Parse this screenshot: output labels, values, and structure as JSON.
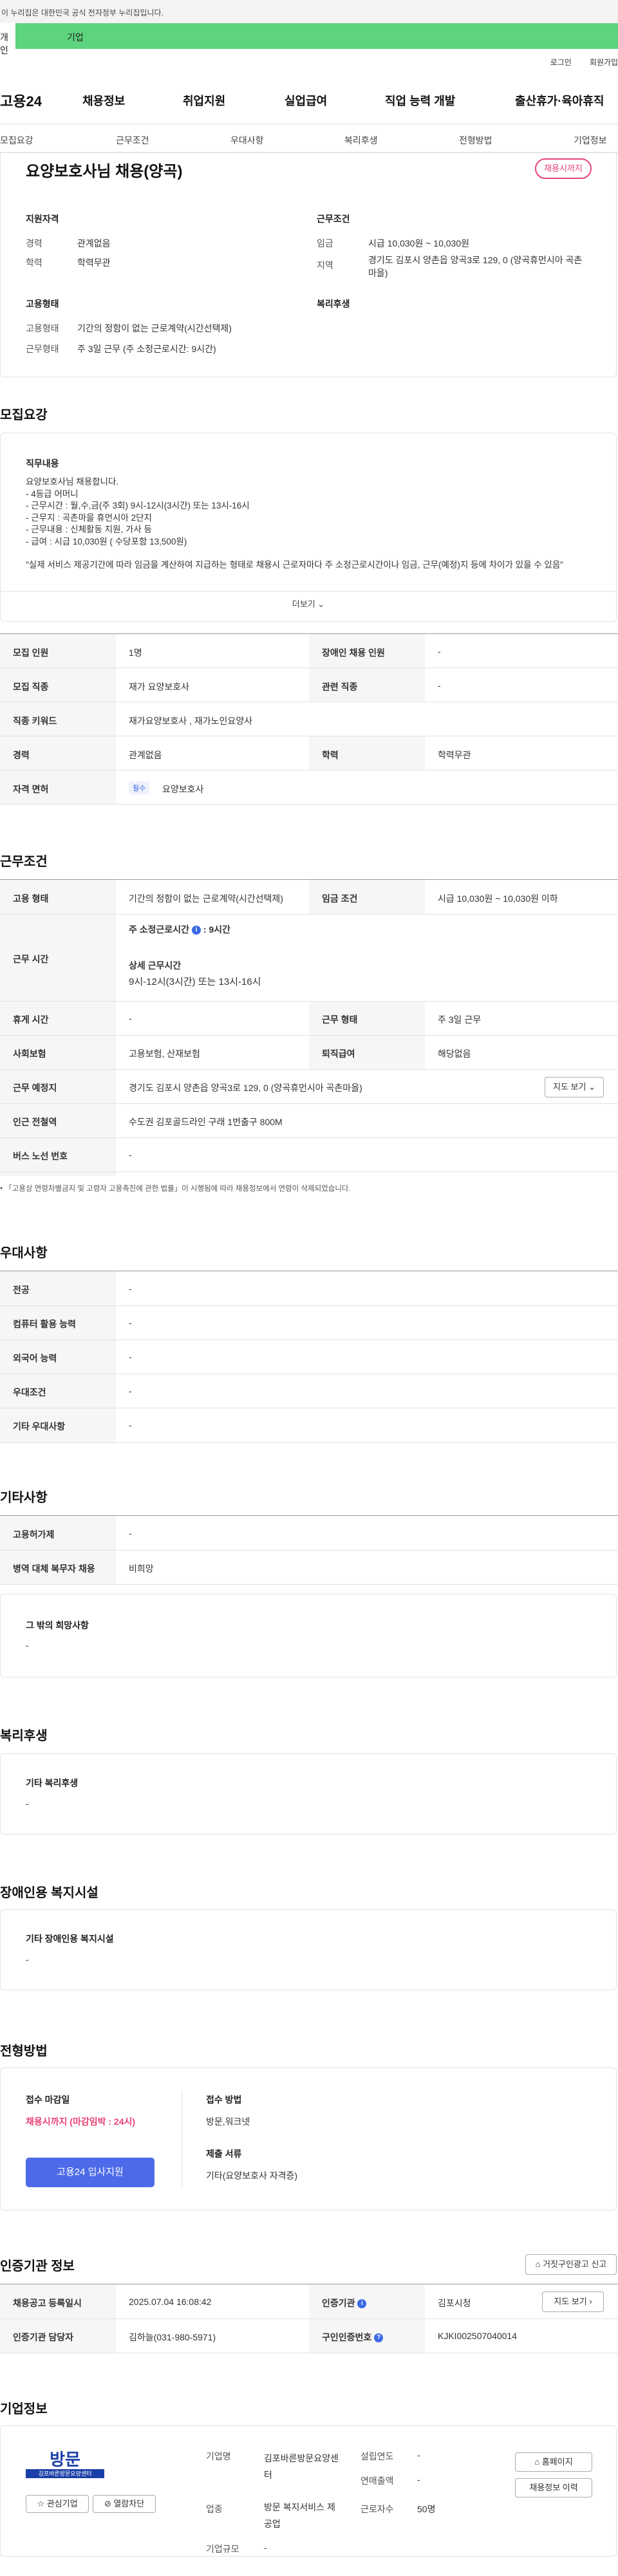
{
  "gov_banner": "이 누리집은 대한민국 공식 전자정부 누리집입니다.",
  "user_tabs": {
    "personal": "개인",
    "corporate": "기업"
  },
  "top_links": {
    "login": "로그인",
    "join": "회원가입"
  },
  "logo": "고용24",
  "gnb": [
    "채용정보",
    "취업지원",
    "실업급여",
    "직업 능력 개발",
    "출산휴가·육아휴직"
  ],
  "anchors": [
    "모집요강",
    "근무조건",
    "우대사항",
    "복리후생",
    "전형방법",
    "기업정보"
  ],
  "summary": {
    "title": "요양보호사님 채용(양곡)",
    "deadline_badge": "채용시까지",
    "qual_header": "지원자격",
    "career_label": "경력",
    "career_value": "관계없음",
    "edu_label": "학력",
    "edu_value": "학력무관",
    "cond_header": "근무조건",
    "wage_label": "임금",
    "wage_value": "시급 10,030원 ~ 10,030원",
    "region_label": "지역",
    "region_value": "경기도 김포시 양촌읍 양곡3로 129, 0 (양곡휴먼시아 곡촌마을)",
    "emp_header": "고용형태",
    "emptype_label": "고용형태",
    "emptype_value": "기간의 정함이 없는 근로계약(시간선택제)",
    "worktype_label": "근무형태",
    "worktype_value": "주 3일 근무 (주 소정근로시간: 9시간)",
    "welfare_header": "복리후생"
  },
  "recruit": {
    "section_title": "모집요강",
    "duty_header": "직무내용",
    "duty_lines": [
      "요양보호사님 채용합니다.",
      "- 4등급 어머니",
      "- 근무시간 : 월,수,금(주 3회)   9시-12시(3시간)  또는 13시-16시",
      "- 근무지 : 곡촌마을 휴먼시아 2단지",
      "- 근무내용 : 신체활동 지원, 가사 등",
      "- 급여 : 시급 10,030원 ( 수당포함 13,500원)",
      "",
      "\"실제 서비스 제공기간에 따라 임금을 계산하여 지급하는 형태로 채용시 근로자마다 주 소정근로시간이나 임금, 근무(예정)지 등에 차이가 있을 수 있음\""
    ],
    "more_label": "더보기",
    "rows": [
      {
        "l1": "모집 인원",
        "v1": "1명",
        "l2": "장애인 채용 인원",
        "v2": "-"
      },
      {
        "l1": "모집 직종",
        "v1": "재가 요양보호사",
        "l2": "관련 직종",
        "v2": "-"
      },
      {
        "l1": "직종 키워드",
        "v1": "재가요양보호사 , 재가노인요양사"
      },
      {
        "l1": "경력",
        "v1": "관계없음",
        "l2": "학력",
        "v2": "학력무관"
      },
      {
        "l1": "자격 면허",
        "tag": "필수",
        "v1": "요양보호사"
      }
    ]
  },
  "conditions": {
    "section_title": "근무조건",
    "emp_label": "고용 형태",
    "emp_value": "기간의 정함이 없는 근로계약(시간선택제)",
    "wage_label": "임금 조건",
    "wage_value": "시급 10,030원 ~ 10,030원 이하",
    "hours_label": "근무 시간",
    "weekly_label": "주 소정근로시간",
    "weekly_value": ": 9시간",
    "detail_label": "상세 근무시간",
    "detail_value": "9시-12시(3시간)  또는 13시-16시",
    "rest_label": "휴게 시간",
    "rest_value": "-",
    "worktype_label": "근무 형태",
    "worktype_value": "주 3일 근무",
    "ins_label": "사회보험",
    "ins_value": "고용보험, 산재보험",
    "retire_label": "퇴직급여",
    "retire_value": "해당없음",
    "place_label": "근무 예정지",
    "place_value": "경기도 김포시 양촌읍 양곡3로 129, 0 (양곡휴먼시아 곡촌마을)",
    "map_button": "지도 보기",
    "subway_label": "인근 전철역",
    "subway_value": "수도권 김포골드라인 구래 1번출구 800M",
    "bus_label": "버스 노선 번호",
    "bus_value": "-",
    "note": "「고용상 연령차별금지 및 고령자 고용촉진에 관한 법률」이 시행됨에 따라 채용정보에서 연령이 삭제되었습니다."
  },
  "preferences": {
    "section_title": "우대사항",
    "rows": [
      {
        "l": "전공",
        "v": "-"
      },
      {
        "l": "컴퓨터 활용 능력",
        "v": "-"
      },
      {
        "l": "외국어 능력",
        "v": "-"
      },
      {
        "l": "우대조건",
        "v": "-"
      },
      {
        "l": "기타 우대사항",
        "v": "-"
      }
    ]
  },
  "others": {
    "section_title": "기타사항",
    "rows": [
      {
        "l": "고용허가제",
        "v": "-"
      },
      {
        "l": "병역 대체 복무자 채용",
        "v": "비희망"
      }
    ],
    "wish_header": "그 밖의 희망사항",
    "wish_value": "-"
  },
  "welfare": {
    "section_title": "복리후생",
    "box_header": "기타 복리후생",
    "box_value": "-"
  },
  "disability": {
    "section_title": "장애인용 복지시설",
    "box_header": "기타 장애인용 복지시설",
    "box_value": "-"
  },
  "selection": {
    "section_title": "전형방법",
    "deadline_label": "접수 마감일",
    "deadline_value": "채용시까지 (마감임박 : 24시)",
    "apply_button": "고용24 입사지원",
    "method_label": "접수 방법",
    "method_value": "방문,워크넷",
    "docs_label": "제출 서류",
    "docs_value": "기타(요양보호사 자격증)"
  },
  "agency": {
    "section_title": "인증기관 정보",
    "report_button": "거짓구인광고 신고",
    "reg_label": "채용공고 등록일시",
    "reg_value": "2025.07.04 16:08:42",
    "org_label": "인증기관",
    "org_value": "김포시청",
    "map_button": "지도 보기",
    "contact_label": "인증기관 담당자",
    "contact_value": "김하늘(031-980-5971)",
    "id_label": "구인인증번호",
    "id_value": "KJKI002507040014"
  },
  "company": {
    "section_title": "기업정보",
    "logo_text": "방문",
    "logo_sub": "김포바른방문요양센터",
    "fav_button": "관심기업",
    "block_button": "열람차단",
    "name_label": "기업명",
    "name_value": "김포바른방문요양센터",
    "industry_label": "업종",
    "industry_value": "방문 복지서비스 제공업",
    "size_label": "기업규모",
    "size_value": "-",
    "founded_label": "설립연도",
    "founded_value": "-",
    "revenue_label": "연매출액",
    "revenue_value": "-",
    "employees_label": "근로자수",
    "employees_value": "50명",
    "homepage_button": "홈페이지",
    "jobs_button": "채용정보 이력"
  },
  "colors": {
    "accent": "#5ed47f",
    "brand_blue": "#3a68e6",
    "apply_btn": "#4d6be8",
    "deadline": "#e94374"
  }
}
